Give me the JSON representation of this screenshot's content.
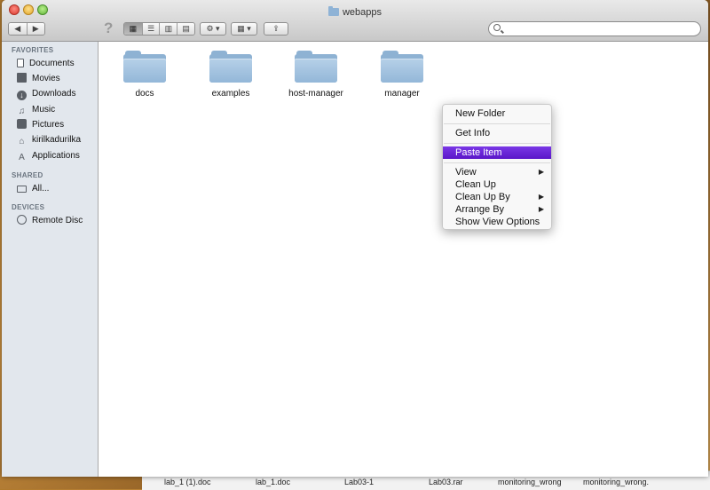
{
  "window": {
    "title": "webapps"
  },
  "toolbar": {
    "back_label": "◀",
    "forward_label": "▶",
    "help_label": "?",
    "view_icon": "▦",
    "list_icon": "☰",
    "column_icon": "▥",
    "coverflow_icon": "▤",
    "action_label": "⚙ ▾",
    "arrange_label": "▦ ▾",
    "share_label": "⇪",
    "search_placeholder": ""
  },
  "sidebar": {
    "sections": [
      {
        "title": "FAVORITES"
      },
      {
        "title": "SHARED"
      },
      {
        "title": "DEVICES"
      }
    ],
    "favorites": [
      {
        "label": "Documents",
        "icon": "document-icon"
      },
      {
        "label": "Movies",
        "icon": "movie-icon"
      },
      {
        "label": "Downloads",
        "icon": "download-icon"
      },
      {
        "label": "Music",
        "icon": "music-icon"
      },
      {
        "label": "Pictures",
        "icon": "camera-icon"
      },
      {
        "label": "kirilkadurilka",
        "icon": "home-icon"
      },
      {
        "label": "Applications",
        "icon": "applications-icon"
      }
    ],
    "shared": [
      {
        "label": "All...",
        "icon": "network-icon"
      }
    ],
    "devices": [
      {
        "label": "Remote Disc",
        "icon": "disc-icon"
      }
    ]
  },
  "folders": [
    {
      "name": "docs"
    },
    {
      "name": "examples"
    },
    {
      "name": "host-manager"
    },
    {
      "name": "manager"
    }
  ],
  "context_menu": {
    "items": [
      {
        "label": "New Folder"
      },
      {
        "label": "Get Info"
      },
      {
        "label": "Paste Item",
        "highlighted": true
      },
      {
        "label": "View",
        "submenu": true
      },
      {
        "label": "Clean Up"
      },
      {
        "label": "Clean Up By",
        "submenu": true
      },
      {
        "label": "Arrange By",
        "submenu": true
      },
      {
        "label": "Show View Options"
      }
    ],
    "submenu_arrow": "▶"
  },
  "desktop_files": [
    {
      "name": "lab_1 (1).doc"
    },
    {
      "name": "lab_1.doc"
    },
    {
      "name": "Lab03-1"
    },
    {
      "name": "Lab03.rar"
    },
    {
      "name": "monitoring_wrong"
    },
    {
      "name": "monitoring_wrong."
    }
  ],
  "colors": {
    "highlight": "#6a27d8",
    "folder": "#93b7d8",
    "sidebar": "#e2e7ed"
  }
}
